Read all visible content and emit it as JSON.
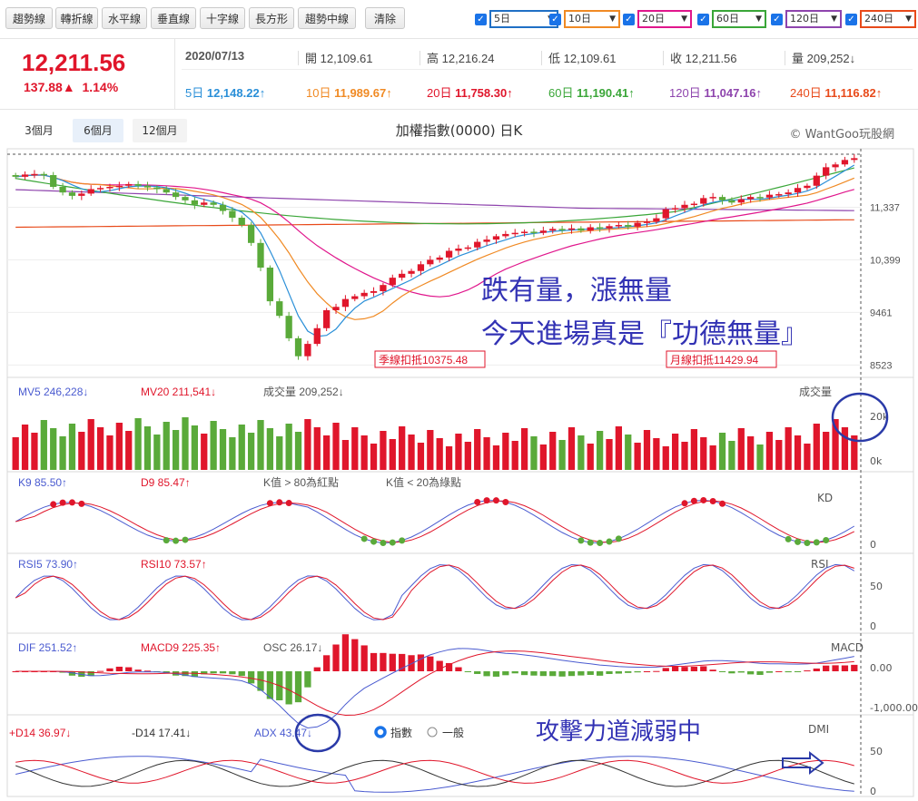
{
  "toolbar": {
    "buttons": [
      "趨勢線",
      "轉折線",
      "水平線",
      "垂直線",
      "十字線",
      "長方形",
      "趨勢中線",
      "清除"
    ],
    "ma_options": [
      {
        "label": "5日",
        "color": "#1f6fc5"
      },
      {
        "label": "10日",
        "color": "#f08a24"
      },
      {
        "label": "20日",
        "color": "#e0168c"
      },
      {
        "label": "60日",
        "color": "#3aa638"
      },
      {
        "label": "120日",
        "color": "#8e44ad"
      },
      {
        "label": "240日",
        "color": "#e84a1a"
      }
    ]
  },
  "quote": {
    "price": "12,211.56",
    "change": "137.88▲",
    "change_pct": "1.14%",
    "date": "2020/07/13",
    "open_label": "開",
    "open": "12,109.61",
    "high_label": "高",
    "high": "12,216.24",
    "low_label": "低",
    "low": "12,109.61",
    "close_label": "收",
    "close": "12,211.56",
    "vol_label": "量",
    "vol": "209,252↓",
    "ma": [
      {
        "label": "5日",
        "value": "12,148.22↑",
        "color": "#2a8fd8"
      },
      {
        "label": "10日",
        "value": "11,989.67↑",
        "color": "#f08a24"
      },
      {
        "label": "20日",
        "value": "11,758.30↑",
        "color": "#e0162b"
      },
      {
        "label": "60日",
        "value": "11,190.41↑",
        "color": "#3aa638"
      },
      {
        "label": "120日",
        "value": "11,047.16↑",
        "color": "#8e44ad"
      },
      {
        "label": "240日",
        "value": "11,116.82↑",
        "color": "#e84a1a"
      }
    ]
  },
  "range_tabs": [
    "3個月",
    "6個月",
    "12個月"
  ],
  "chart_title": "加權指數(0000) 日K",
  "watermark": "© WantGoo玩股網",
  "chart_data": {
    "type": "candlestick",
    "colors": {
      "up": "#e0162b",
      "down": "#5aaa3a",
      "ma5": "#2a8fd8",
      "ma10": "#f08a24",
      "ma20": "#e0168c",
      "ma60": "#3aa638",
      "ma120": "#8e44ad",
      "ma240": "#e84a1a"
    },
    "price_axis": {
      "ticks": [
        "11,337",
        "10,399",
        "9461",
        "8523"
      ],
      "ylim": [
        8400,
        12250
      ]
    },
    "ohlc_close": [
      11880,
      11920,
      11930,
      11910,
      11700,
      11600,
      11540,
      11580,
      11660,
      11680,
      11700,
      11720,
      11750,
      11720,
      11690,
      11660,
      11600,
      11520,
      11460,
      11380,
      11420,
      11380,
      11270,
      11150,
      11020,
      10700,
      10260,
      9660,
      9400,
      9000,
      8680,
      8900,
      9180,
      9500,
      9560,
      9700,
      9750,
      9810,
      9840,
      9950,
      10080,
      10150,
      10200,
      10320,
      10400,
      10440,
      10560,
      10600,
      10620,
      10720,
      10760,
      10820,
      10860,
      10880,
      10900,
      10880,
      10920,
      10950,
      10940,
      10960,
      10920,
      10980,
      10960,
      11000,
      11020,
      10990,
      11060,
      11080,
      11140,
      11300,
      11320,
      11380,
      11400,
      11500,
      11520,
      11460,
      11420,
      11480,
      11520,
      11510,
      11560,
      11570,
      11600,
      11680,
      11720,
      11900,
      12050,
      12100,
      12180,
      12211.56
    ],
    "labels": {
      "quarter_line": "季線扣抵10375.48",
      "month_line": "月線扣抵11429.94"
    },
    "volume": {
      "mv5": "246,228↓",
      "mv20": "211,541↓",
      "vol": "成交量 209,252↓",
      "title": "成交量",
      "ticks": [
        "20k",
        "0k"
      ]
    },
    "kd": {
      "k": "85.50↑",
      "d": "85.47↑",
      "note1": "K值 > 80為紅點",
      "note2": "K值 < 20為綠點",
      "title": "KD",
      "ticks": [
        "0"
      ]
    },
    "rsi": {
      "rsi5": "73.90↑",
      "rsi10": "73.57↑",
      "title": "RSI",
      "ticks": [
        "50",
        "0"
      ]
    },
    "macd": {
      "dif": "251.52↑",
      "macd9": "225.35↑",
      "osc": "26.17↓",
      "title": "MACD",
      "ticks": [
        "0.00",
        "-1,000.00"
      ]
    },
    "dmi": {
      "pdi": "+D14 36.97↓",
      "mdi": "-D14 17.41↓",
      "adx": "ADX 43.47↓",
      "opt1": "指數",
      "opt2": "一般",
      "title": "DMI",
      "ticks": [
        "50",
        "0"
      ]
    }
  },
  "annotations": {
    "text1": "跌有量，漲無量",
    "text2": "今天進場真是『功德無量』",
    "text3": "攻擊力道減弱中"
  }
}
